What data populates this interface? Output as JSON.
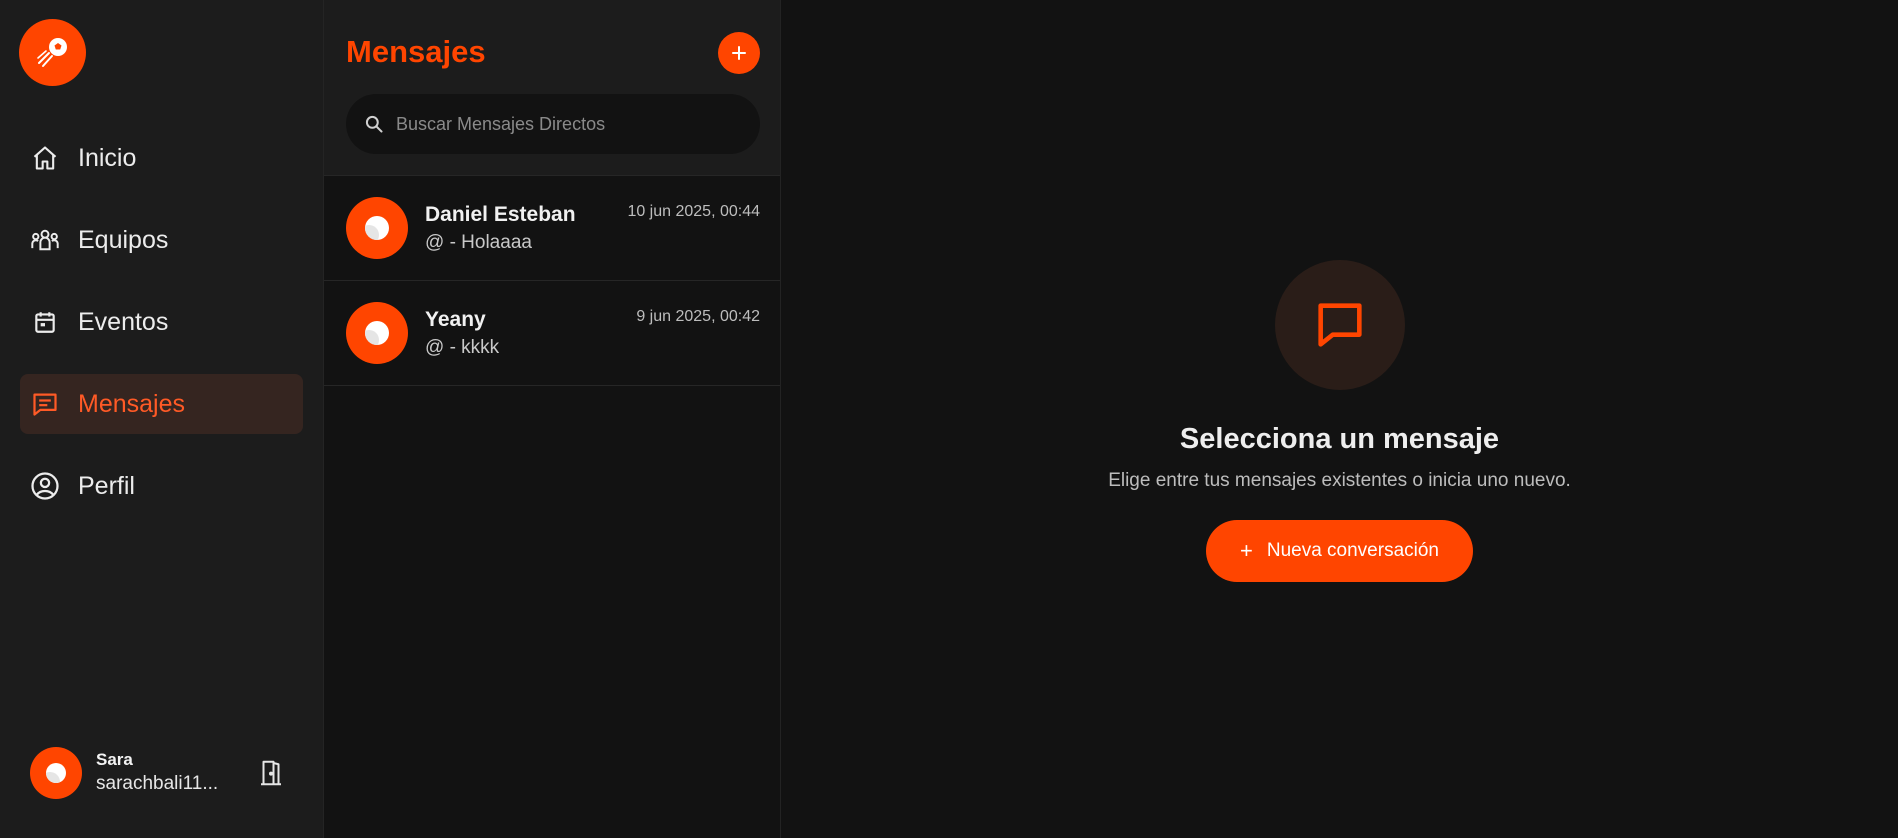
{
  "sidebar": {
    "logo_icon": "soccer-ball-icon",
    "items": [
      {
        "label": "Inicio",
        "icon": "home-icon"
      },
      {
        "label": "Equipos",
        "icon": "team-icon"
      },
      {
        "label": "Eventos",
        "icon": "calendar-icon"
      },
      {
        "label": "Mensajes",
        "icon": "chat-icon",
        "active": true
      },
      {
        "label": "Perfil",
        "icon": "user-circle-icon"
      }
    ],
    "user": {
      "name": "Sara",
      "handle": "sarachbali11..."
    }
  },
  "messages": {
    "title": "Mensajes",
    "new_button_symbol": "+",
    "search": {
      "placeholder": "Buscar Mensajes Directos"
    },
    "conversations": [
      {
        "name": "Daniel Esteban",
        "preview": "@ - Holaaaa",
        "time": "10 jun 2025, 00:44"
      },
      {
        "name": "Yeany",
        "preview": "@ - kkkk",
        "time": "9 jun 2025, 00:42"
      }
    ]
  },
  "main": {
    "empty_title": "Selecciona un mensaje",
    "empty_subtitle": "Elige entre tus mensajes existentes o inicia uno nuevo.",
    "cta_symbol": "+",
    "cta_label": "Nueva conversación"
  },
  "colors": {
    "accent": "#ff4500",
    "sidebar_bg": "#1c1c1c",
    "page_bg": "#121212",
    "active_item_bg": "#352520"
  }
}
